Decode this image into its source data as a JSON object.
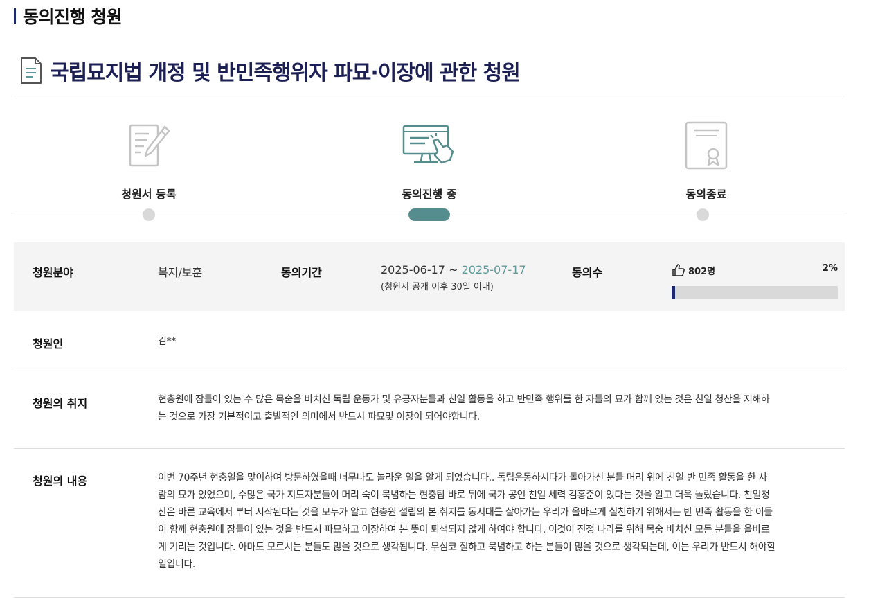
{
  "section": {
    "title": "동의진행 청원"
  },
  "petition": {
    "title": "국립묘지법 개정 및 반민족행위자 파묘·이장에 관한 청원"
  },
  "steps": [
    {
      "label": "청원서 등록"
    },
    {
      "label": "동의진행 중"
    },
    {
      "label": "동의종료"
    }
  ],
  "info": {
    "category_label": "청원분야",
    "category_value": "복지/보훈",
    "period_label": "동의기간",
    "period_start": "2025-06-17 ~ ",
    "period_end": "2025-07-17",
    "period_note": "(청원서 공개 이후 30일 이내)",
    "count_label": "동의수",
    "count_value": "802명",
    "percent_text": "2%",
    "progress": 0.02
  },
  "petitioner": {
    "label": "청원인",
    "value": "김**"
  },
  "purpose": {
    "label": "청원의 취지",
    "lines": [
      "현충원에 잠들어 있는 수 많은 목숨을 바치신  독립 운동가 및 유공자분들과  친일 활동을 하고 반민족 행위를 한 자들의 묘가 함께 있는 것은 친일 청산을 저해하",
      "는 것으로 가장 기본적이고 출발적인 의미에서 반드시 파묘및 이장이 되어야합니다."
    ]
  },
  "content": {
    "label": "청원의 내용",
    "lines": [
      "이번 70주년 현충일을 맞이하여 방문하였을때 너무나도 놀라운 일을 알게 되었습니다..  독립운동하시다가 돌아가신 분들 머리 위에 친일 반 민족 활동을 한 사",
      "람의 묘가 있었으며, 수많은 국가 지도자분들이 머리 숙여 묵념하는 현충탑 바로 뒤에 국가 공인 친일 세력 김홍준이 있다는 것을 알고 더욱 놀랐습니다. 친일청",
      "산은 바른 교육에서 부터 시작된다는 것을 모두가 알고 현충원 설립의 본 취지를 동시대를 살아가는 우리가 올바르게 실천하기 위해서는 반 민족 활동을 한 이들",
      "이 함께 현충원에 잠들어 있는 것을 반드시 파묘하고 이장하여 본 뜻이 퇴색되지 않게 하여야 합니다. 이것이 진정 나라를 위해 목숨 바치신 모든 분들을 올바르",
      "게 기리는 것입니다. 아마도 모르시는 분들도 많을 것으로 생각됩니다. 무심코 절하고 묵념하고 하는 분들이 많을 것으로 생각되는데, 이는 우리가 반드시 해야할",
      "일입니다."
    ]
  },
  "icons": {
    "title": "document-icon",
    "step1": "petition-write-icon",
    "step2": "computer-click-icon",
    "step3": "certificate-icon",
    "likes": "thumbs-up-icon"
  },
  "colors": {
    "accent": "#1e2a6d",
    "teal": "#558c8e",
    "title": "#1c1f54",
    "date_end": "#5f9a9a"
  }
}
